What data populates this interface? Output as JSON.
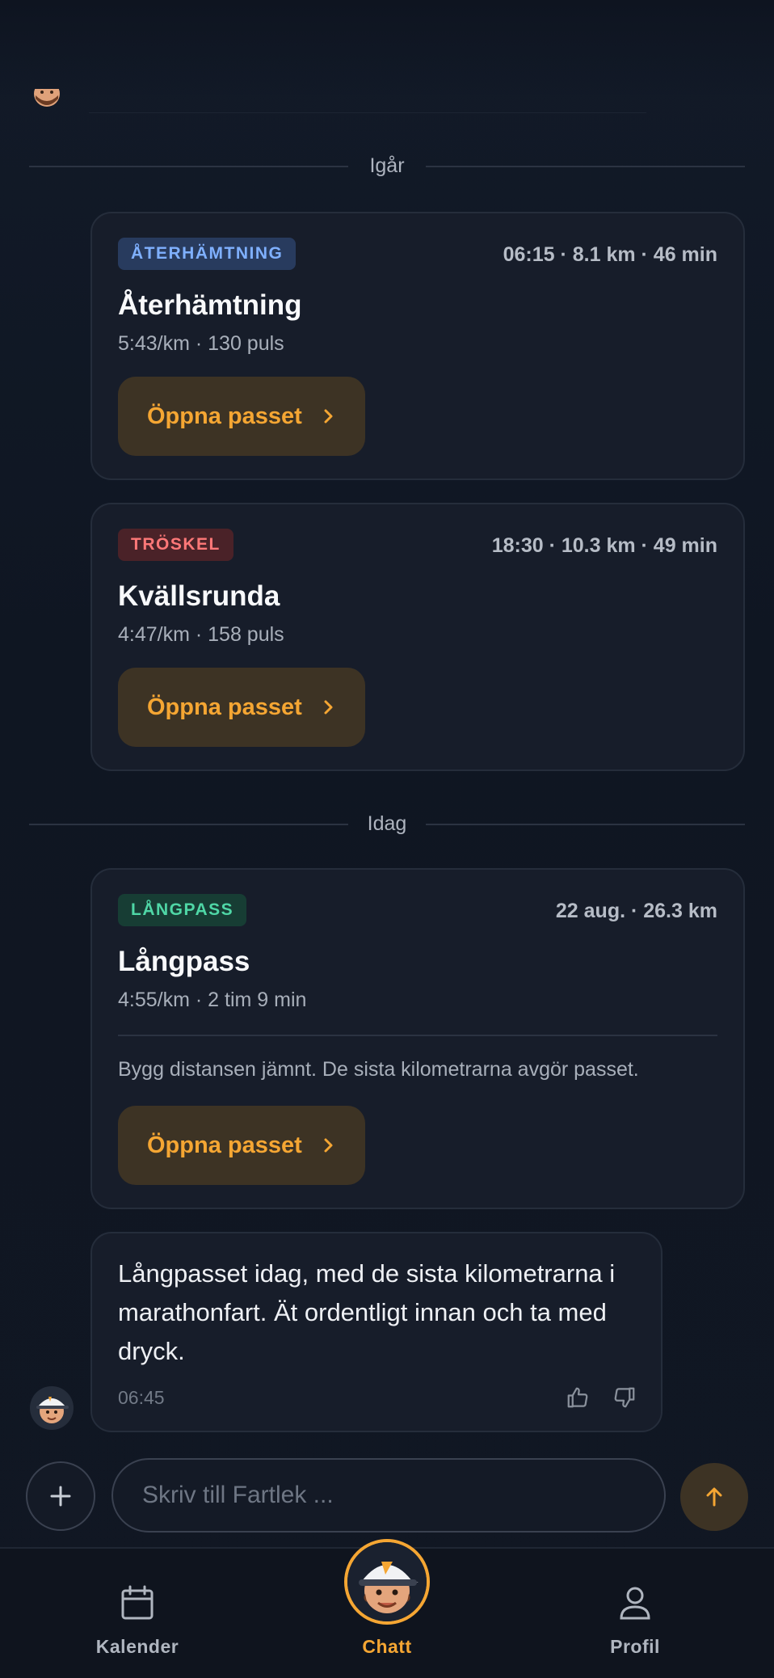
{
  "feed": {
    "dividers": {
      "yesterday": "Igår",
      "today": "Idag"
    },
    "workouts": [
      {
        "badge": "ÅTERHÄMTNING",
        "badge_color": "#7fb0ff",
        "meta": "06:15 · 8.1 km · 46 min",
        "title": "Återhämtning",
        "stats": "5:43/km · 130 puls",
        "button": "Öppna passet"
      },
      {
        "badge": "TRÖSKEL",
        "badge_color": "#ff7878",
        "meta": "18:30 · 10.3 km · 49 min",
        "title": "Kvällsrunda",
        "stats": "4:47/km · 158 puls",
        "button": "Öppna passet"
      },
      {
        "badge": "LÅNGPASS",
        "badge_color": "#4fd7a6",
        "meta": "22 aug. · 26.3 km",
        "title": "Långpass",
        "stats": "4:55/km · 2 tim 9 min",
        "note": "Bygg distansen jämnt. De sista kilometrarna avgör passet.",
        "button": "Öppna passet"
      }
    ],
    "message": {
      "text": "Långpasset idag, med de sista kilometrarna i marathonfart. Ät ordentligt innan och ta med dryck.",
      "time": "06:45",
      "feedback_icons": [
        "thumbs-up-icon",
        "thumbs-down-icon"
      ]
    }
  },
  "composer": {
    "placeholder": "Skriv till Fartlek ...",
    "value": ""
  },
  "nav": {
    "calendar": "Kalender",
    "chat": "Chatt",
    "profile": "Profil"
  },
  "colors": {
    "accent": "#f5a633",
    "background": "#111723",
    "card": "#171d2a"
  }
}
